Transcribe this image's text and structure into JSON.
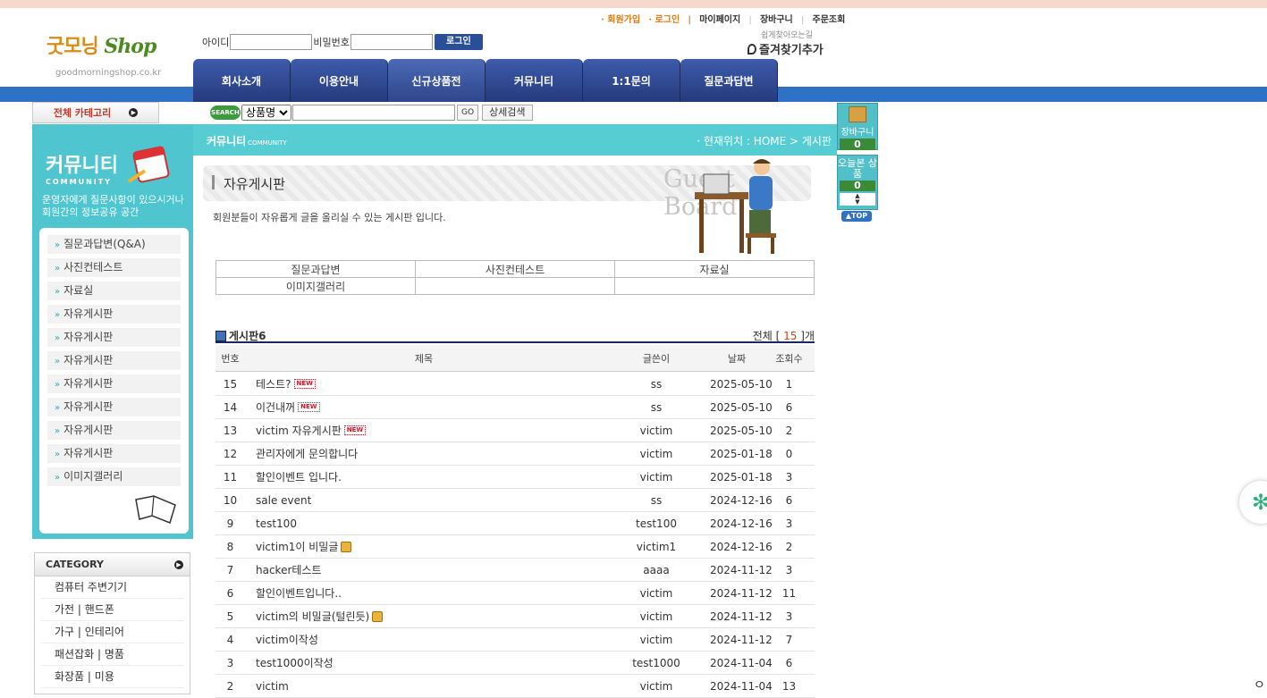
{
  "header": {
    "logo_text": "굿모닝",
    "logo_text_en": "Shop",
    "logo_sub": "goodmorningshop.co.kr",
    "links": [
      "· 회원가입",
      "· 로그인",
      "|",
      "마이페이지",
      "|",
      "장바구니",
      "|",
      "주문조회"
    ],
    "login": {
      "id_label": "아이디",
      "pw_label": "비밀번호",
      "button": "로그인"
    },
    "bookmark_small": "쉽게찾아오는길",
    "bookmark_label": "즐겨찾기추가",
    "tabs": [
      "회사소개",
      "이용안내",
      "신규상품전",
      "커뮤니티",
      "1:1문의",
      "질문과답변"
    ]
  },
  "search": {
    "all_category": "전체 카테고리",
    "badge": "SEARCH",
    "select_value": "상품명",
    "go": "GO",
    "detail": "상세검색"
  },
  "sidebar": {
    "title": "커뮤니티",
    "title_en": "COMMUNITY",
    "desc": "운영자에게 질문사항이 있으시거나 회원간의 정보공유 공간",
    "menu": [
      "질문과답변(Q&A)",
      "사진컨테스트",
      "자료실",
      "자유게시판",
      "자유게시판",
      "자유게시판",
      "자유게시판",
      "자유게시판",
      "자유게시판",
      "자유게시판",
      "이미지갤러리"
    ],
    "category_title": "CATEGORY",
    "categories": [
      "컴퓨터 주변기기",
      "가전 | 핸드폰",
      "가구 | 인테리어",
      "패션잡화 | 명품",
      "화장품 | 미용"
    ]
  },
  "content": {
    "section_label": "커뮤니티",
    "section_label_en": "COMMUNITY",
    "location": "· 현재위치 : HOME > 게시판",
    "board_title": "자유게시판",
    "watermark": "Guest Board",
    "intro": "회원분들이 자유롭게 글을 올리실 수 있는 게시판 입니다.",
    "board_links": [
      [
        "질문과답변",
        "사진컨테스트",
        "자료실"
      ],
      [
        "이미지갤러리",
        "",
        ""
      ]
    ],
    "list_title": "게시판6",
    "total_prefix": "전체 [",
    "total_count": "15",
    "total_suffix": "]개",
    "columns": [
      "번호",
      "제목",
      "글쓴이",
      "날짜",
      "조회수"
    ],
    "rows": [
      {
        "num": "15",
        "title": "테스트?",
        "new": true,
        "lock": false,
        "writer": "ss",
        "date": "2025-05-10",
        "views": "1"
      },
      {
        "num": "14",
        "title": "이건내꺼",
        "new": true,
        "lock": false,
        "writer": "ss",
        "date": "2025-05-10",
        "views": "6"
      },
      {
        "num": "13",
        "title": "victim 자유게시판",
        "new": true,
        "lock": false,
        "writer": "victim",
        "date": "2025-05-10",
        "views": "2"
      },
      {
        "num": "12",
        "title": "관리자에게 문의합니다",
        "new": false,
        "lock": false,
        "writer": "victim",
        "date": "2025-01-18",
        "views": "0"
      },
      {
        "num": "11",
        "title": "할인이벤트 입니다.",
        "new": false,
        "lock": false,
        "writer": "victim",
        "date": "2025-01-18",
        "views": "3"
      },
      {
        "num": "10",
        "title": "sale event",
        "new": false,
        "lock": false,
        "writer": "ss",
        "date": "2024-12-16",
        "views": "6"
      },
      {
        "num": "9",
        "title": "test100",
        "new": false,
        "lock": false,
        "writer": "test100",
        "date": "2024-12-16",
        "views": "3"
      },
      {
        "num": "8",
        "title": "victim1이 비밀글",
        "new": false,
        "lock": true,
        "writer": "victim1",
        "date": "2024-12-16",
        "views": "2"
      },
      {
        "num": "7",
        "title": "hacker테스트",
        "new": false,
        "lock": false,
        "writer": "aaaa",
        "date": "2024-11-12",
        "views": "3"
      },
      {
        "num": "6",
        "title": "할인이벤트입니다..",
        "new": false,
        "lock": false,
        "writer": "victim",
        "date": "2024-11-12",
        "views": "11"
      },
      {
        "num": "5",
        "title": "victim의 비밀글(털린듯)",
        "new": false,
        "lock": true,
        "writer": "victim",
        "date": "2024-11-12",
        "views": "3"
      },
      {
        "num": "4",
        "title": "victim이작성",
        "new": false,
        "lock": false,
        "writer": "victim",
        "date": "2024-11-12",
        "views": "7"
      },
      {
        "num": "3",
        "title": "test1000이작성",
        "new": false,
        "lock": false,
        "writer": "test1000",
        "date": "2024-11-04",
        "views": "6"
      },
      {
        "num": "2",
        "title": "victim",
        "new": false,
        "lock": false,
        "writer": "victim",
        "date": "2024-11-04",
        "views": "13"
      }
    ],
    "new_badge": "NEW"
  },
  "widget": {
    "cart_label": "장바구니",
    "cart_count": "0",
    "today_label": "오늘본 상품",
    "today_count": "0",
    "top": "TOP"
  },
  "colors": {
    "accent_teal": "#4fc6cf",
    "nav_blue": "#2f71c5",
    "tab_navy": "#263a7c"
  }
}
